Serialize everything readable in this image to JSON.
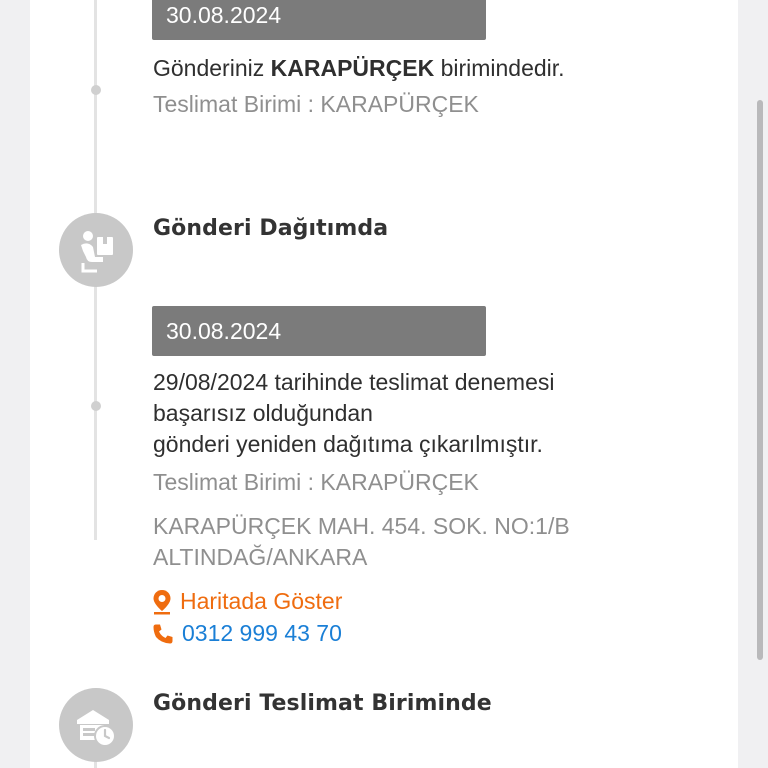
{
  "events": [
    {
      "date": "30.08.2024",
      "message_prefix": "Gönderiniz ",
      "message_bold": "KARAPÜRÇEK",
      "message_suffix": " birimindedir.",
      "unit": "Teslimat Birimi : KARAPÜRÇEK"
    },
    {
      "status": "Gönderi Dağıtımda",
      "status_icon": "delivery-person-icon"
    },
    {
      "date": "30.08.2024",
      "message_lines": [
        "29/08/2024 tarihinde teslimat denemesi",
        "başarısız olduğundan",
        "gönderi yeniden dağıtıma çıkarılmıştır."
      ],
      "unit": "Teslimat Birimi : KARAPÜRÇEK",
      "address_lines": [
        "KARAPÜRÇEK MAH. 454. SOK. NO:1/B",
        "ALTINDAĞ/ANKARA"
      ],
      "map_link": "Haritada Göster",
      "phone": "0312 999 43 70"
    },
    {
      "status": "Gönderi Teslimat Biriminde",
      "status_icon": "branch-clock-icon"
    }
  ],
  "colors": {
    "date_badge": "#7b7b7b",
    "accent_orange": "#ef6c0f",
    "link_blue": "#1a7fd6",
    "icon_circle": "#c8c8c8"
  }
}
